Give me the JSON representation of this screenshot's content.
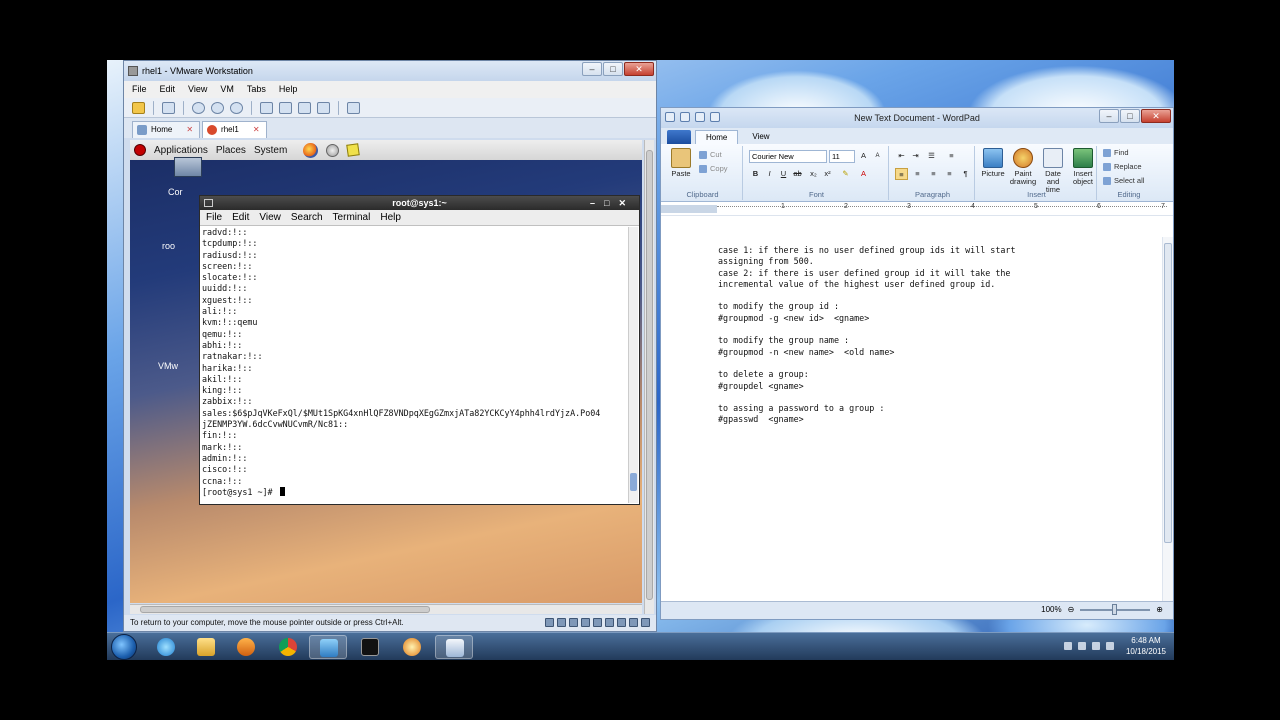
{
  "vmware": {
    "title": "rhel1 - VMware Workstation",
    "menu": [
      "File",
      "Edit",
      "View",
      "VM",
      "Tabs",
      "Help"
    ],
    "tabs": [
      {
        "label": "Home"
      },
      {
        "label": "rhel1"
      }
    ],
    "status": "To return to your computer, move the mouse pointer outside or press Ctrl+Alt."
  },
  "guest": {
    "panel": {
      "applications": "Applications",
      "places": "Places",
      "system": "System"
    },
    "desktop_labels": [
      "Cor",
      "roo",
      "VMw"
    ]
  },
  "terminal": {
    "title": "root@sys1:~",
    "menu": [
      "File",
      "Edit",
      "View",
      "Search",
      "Terminal",
      "Help"
    ],
    "lines": [
      "radvd:!::",
      "tcpdump:!::",
      "radiusd:!::",
      "screen:!::",
      "slocate:!::",
      "uuidd:!::",
      "xguest:!::",
      "ali:!::",
      "kvm:!::qemu",
      "qemu:!::",
      "abhi:!::",
      "ratnakar:!::",
      "harika:!::",
      "akil:!::",
      "king:!::",
      "zabbix:!::",
      "sales:$6$pJqVKeFxQl/$MUt1SpKG4xnHlQFZ8VNDpqXEgGZmxjATa82YCKCyY4phh4lrdYjzA.Po04",
      "jZENMP3YW.6dcCvwNUCvmR/Nc81::",
      "fin:!::",
      "mark:!::",
      "admin:!::",
      "cisco:!::",
      "ccna:!::"
    ],
    "prompt": "[root@sys1 ~]# "
  },
  "wordpad": {
    "title": "New Text Document - WordPad",
    "tabs": [
      "Home",
      "View"
    ],
    "clipboard": {
      "paste": "Paste",
      "cut": "Cut",
      "copy": "Copy",
      "group": "Clipboard"
    },
    "font": {
      "family": "Courier New",
      "size": "11",
      "group": "Font"
    },
    "paragraph_group": "Paragraph",
    "insert": {
      "picture": "Picture",
      "paint": "Paint drawing",
      "datetime": "Date and time",
      "object": "Insert object",
      "group": "Insert"
    },
    "editing": {
      "find": "Find",
      "replace": "Replace",
      "select_all": "Select all",
      "group": "Editing"
    },
    "ruler_numbers": [
      "1",
      "2",
      "3",
      "4",
      "5",
      "6",
      "7"
    ],
    "lines": [
      "case 1: if there is no user defined group ids it will start",
      "assigning from 500.",
      "case 2: if there is user defined group id it will take the",
      "incremental value of the highest user defined group id.",
      "",
      "to modify the group id :",
      "#groupmod -g <new id>  <gname>",
      "",
      "to modify the group name :",
      "#groupmod -n <new name>  <old name>",
      "",
      "to delete a group:",
      "#groupdel <gname>",
      "",
      "to assing a password to a group :",
      "#gpasswd  <gname>"
    ],
    "zoom": "100%",
    "zoom_level": 1.0
  },
  "taskbar": {
    "time": "6:48 AM",
    "date": "10/18/2015"
  },
  "colors": {
    "taskbar": "#2f4f78",
    "ribbon": "#dce8f6",
    "terminal_title": "#333333",
    "close_button": "#c54130"
  }
}
